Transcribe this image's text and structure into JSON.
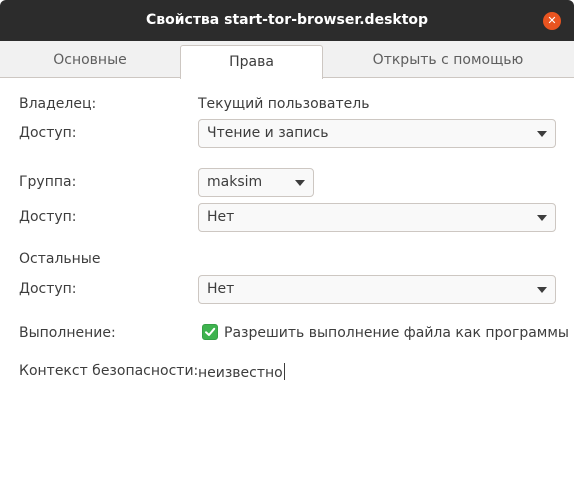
{
  "window": {
    "title": "Свойства start-tor-browser.desktop",
    "close_glyph": "✕"
  },
  "tabs": [
    {
      "label": "Основные"
    },
    {
      "label": "Права"
    },
    {
      "label": "Открыть с помощью"
    }
  ],
  "owner": {
    "label": "Владелец:",
    "value": "Текущий пользователь",
    "access_label": "Доступ:",
    "access_value": "Чтение и запись"
  },
  "group": {
    "label": "Группа:",
    "value": "maksim",
    "access_label": "Доступ:",
    "access_value": "Нет"
  },
  "others": {
    "label": "Остальные",
    "access_label": "Доступ:",
    "access_value": "Нет"
  },
  "execute": {
    "label": "Выполнение:",
    "checkbox_label": "Разрешить выполнение файла как программы",
    "checked": true
  },
  "security": {
    "label": "Контекст безопасности:",
    "value": "неизвестно"
  },
  "colors": {
    "titlebar": "#2c2c2c",
    "close_button": "#e95420",
    "checkbox": "#3eb34f"
  }
}
